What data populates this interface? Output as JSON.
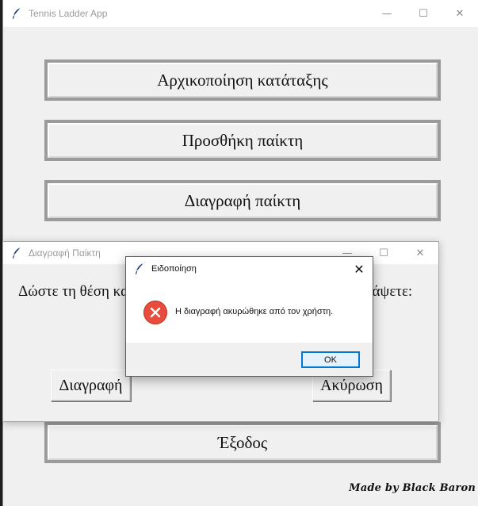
{
  "main_window": {
    "title": "Tennis Ladder App",
    "buttons": {
      "init": "Αρχικοποίηση κατάταξης",
      "add": "Προσθήκη παίκτη",
      "delete": "Διαγραφή παίκτη",
      "exit": "Έξοδος"
    },
    "credit": "Made by Black Baron"
  },
  "delete_window": {
    "title": "Διαγραφή Παίκτη",
    "prompt_start": "Δώστε τη θέση κα",
    "prompt_end": "ράψετε:",
    "delete_button": "Διαγραφή",
    "cancel_button": "Ακύρωση"
  },
  "dialog": {
    "title": "Ειδοποίηση",
    "message": "Η διαγραφή ακυρώθηκε από τον χρήστη.",
    "ok_button": "OK",
    "icon": "error-icon"
  },
  "window_controls": {
    "minimize": "—",
    "maximize": "☐",
    "close": "✕"
  },
  "colors": {
    "accent": "#0078d7",
    "error": "#e74c3c",
    "window_bg": "#f0f0f0"
  }
}
